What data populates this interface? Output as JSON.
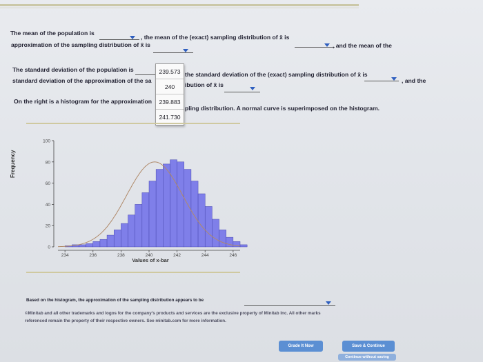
{
  "questions": {
    "q1_part1": "The mean of the population is",
    "q1_part2": ", the mean of the (exact) sampling distribution of x̄ is",
    "q1_part3": ", and the mean of the",
    "q1_line2": "approximation of the sampling distribution of x̄ is",
    "q2_part1": "The standard deviation of the population is",
    "q2_part2": "the standard deviation of the (exact) sampling distribution of x̄ is",
    "q2_part3": ", and the",
    "q2_line2a": "standard deviation of the approximation of the sa",
    "q2_line2b": "ibution of x̄ is",
    "q3_part1": "On the right is a histogram for the approximation",
    "q3_part2": "pling distribution. A normal curve is superimposed on the histogram.",
    "q4": "Based on the histogram, the approximation of the sampling distribution appears to be"
  },
  "dropdown_options": [
    "239.573",
    "240",
    "239.883",
    "241.730"
  ],
  "chart_data": {
    "type": "bar",
    "title": "",
    "xlabel": "Values of x-bar",
    "ylabel": "Frequency",
    "xlim": [
      233.5,
      246.5
    ],
    "ylim": [
      0,
      100
    ],
    "x_ticks": [
      "234",
      "236",
      "238",
      "240",
      "242",
      "244",
      "246"
    ],
    "y_ticks": [
      "0",
      "20",
      "40",
      "60",
      "80",
      "100"
    ],
    "bin_width": 0.5,
    "bins_start": 234.0,
    "values": [
      1,
      2,
      2,
      3,
      5,
      7,
      11,
      16,
      22,
      30,
      40,
      51,
      62,
      73,
      78,
      82,
      80,
      73,
      62,
      50,
      38,
      26,
      16,
      9,
      5,
      2
    ],
    "normal_curve": {
      "mean": 240.4,
      "sd": 2.0,
      "peak": 80
    },
    "bar_color": "#7f7fe9",
    "curve_color": "#b08a6a"
  },
  "footer": {
    "line1": "©Minitab and all other trademarks and logos for the company's products and services are the exclusive property of Minitab Inc. All other marks",
    "line2": "referenced remain the property of their respective owners. See minitab.com for more information."
  },
  "buttons": {
    "grade": "Grade It Now",
    "save": "Save & Continue",
    "continue": "Continue without saving"
  },
  "colors": {
    "button_blue": "#5b8fd3",
    "caret_blue": "#2f5fbf"
  }
}
